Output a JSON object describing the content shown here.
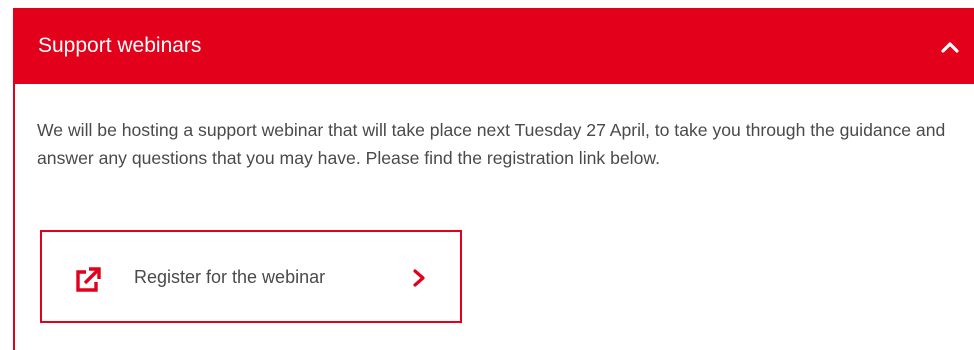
{
  "panel": {
    "title": "Support webinars",
    "expanded": true,
    "collapse_icon": "chevron-up-icon",
    "body_text": "We will be hosting a support webinar that will take place next Tuesday 27 April, to take you through the guidance and answer any questions that you may have. Please find the registration link below.",
    "link": {
      "label": "Register for the webinar",
      "leading_icon": "external-link-icon",
      "trailing_icon": "chevron-right-icon"
    }
  },
  "colors": {
    "accent": "#e3001b",
    "text": "#4a4a4a",
    "header_text": "#ffffff"
  }
}
